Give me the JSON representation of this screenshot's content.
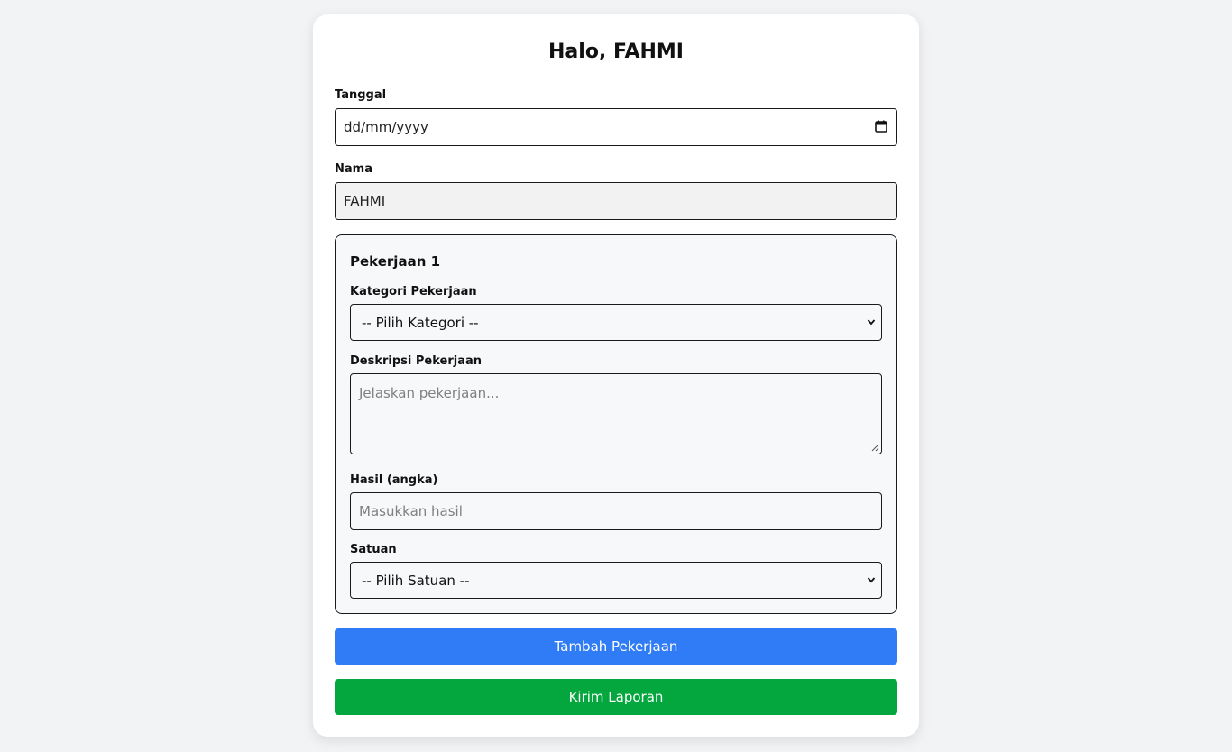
{
  "header": {
    "greeting": "Halo, FAHMI"
  },
  "form": {
    "tanggal": {
      "label": "Tanggal",
      "placeholder": "dd/mm/yyyy",
      "icon": "calendar-icon"
    },
    "nama": {
      "label": "Nama",
      "value": "FAHMI"
    },
    "pekerjaan": [
      {
        "title": "Pekerjaan 1",
        "kategori": {
          "label": "Kategori Pekerjaan",
          "selected": "-- Pilih Kategori --"
        },
        "deskripsi": {
          "label": "Deskripsi Pekerjaan",
          "placeholder": "Jelaskan pekerjaan..."
        },
        "hasil": {
          "label": "Hasil (angka)",
          "placeholder": "Masukkan hasil"
        },
        "satuan": {
          "label": "Satuan",
          "selected": "-- Pilih Satuan --"
        }
      }
    ]
  },
  "actions": {
    "add_label": "Tambah Pekerjaan",
    "submit_label": "Kirim Laporan"
  },
  "colors": {
    "background": "#f2f3f5",
    "card": "#ffffff",
    "add_button": "#2f7cf6",
    "submit_button": "#04a63e",
    "group_background": "#f7f8fa"
  }
}
